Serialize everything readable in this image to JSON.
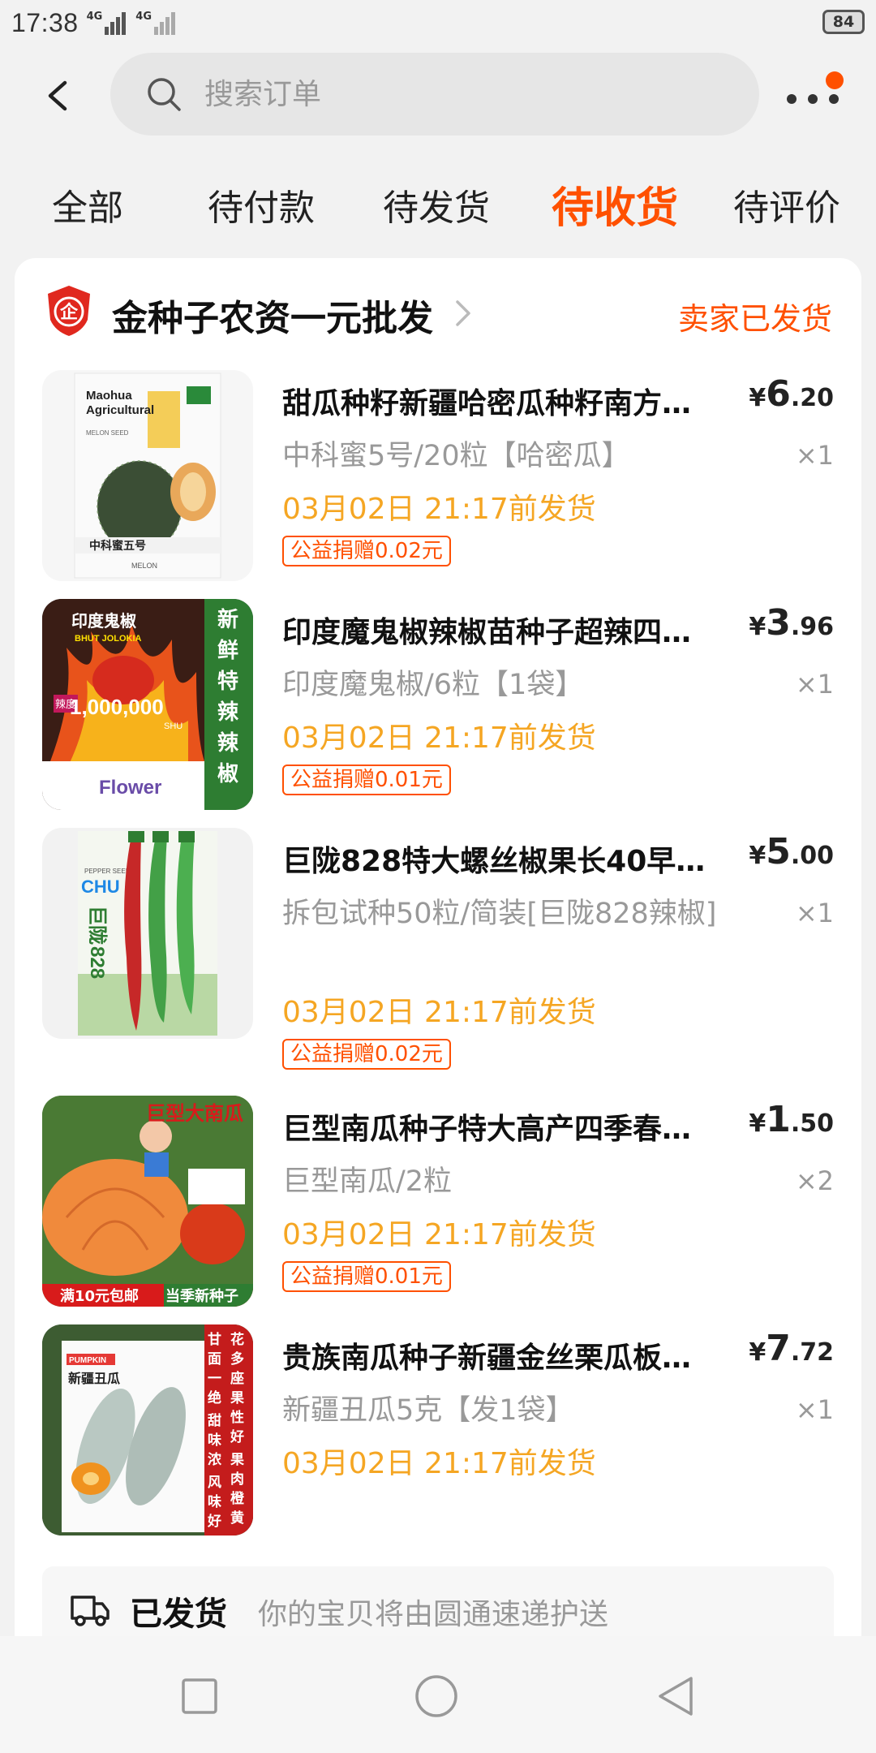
{
  "status_bar": {
    "time": "17:38",
    "network1": "4G",
    "network2": "4G",
    "battery": "84"
  },
  "search": {
    "placeholder": "搜索订单"
  },
  "tabs": [
    {
      "label": "全部"
    },
    {
      "label": "待付款"
    },
    {
      "label": "待发货"
    },
    {
      "label": "待收货",
      "active": true
    },
    {
      "label": "待评价"
    }
  ],
  "shop": {
    "logo_text": "企",
    "name": "金种子农资一元批发",
    "status": "卖家已发货"
  },
  "items": [
    {
      "title": "甜瓜种籽新疆哈密瓜种籽南方…",
      "price_currency": "¥",
      "price_int": "6",
      "price_dec": ".20",
      "sku": "中科蜜5号/20粒【哈密瓜】",
      "qty": "×1",
      "ship": "03月02日 21:17前发货",
      "donate": "公益捐赠0.02元",
      "thumb_text": [
        "Maohua",
        "Agricultural",
        "MELON SEED",
        "中科蜜五号",
        "MELON"
      ]
    },
    {
      "title": "印度魔鬼椒辣椒苗种子超辣四…",
      "price_currency": "¥",
      "price_int": "3",
      "price_dec": ".96",
      "sku": "印度魔鬼椒/6粒【1袋】",
      "qty": "×1",
      "ship": "03月02日 21:17前发货",
      "donate": "公益捐赠0.01元",
      "thumb_text": [
        "印度鬼椒",
        "BHUT JOLOKIA",
        "辣度",
        "1,000,000",
        "SHU",
        "Flower",
        "新鲜特辣辣椒"
      ]
    },
    {
      "title": "巨陇828特大螺丝椒果长40早…",
      "price_currency": "¥",
      "price_int": "5",
      "price_dec": ".00",
      "sku": "拆包试种50粒/简装[巨陇828辣椒]",
      "qty": "×1",
      "ship": "03月02日 21:17前发货",
      "donate": "公益捐赠0.02元",
      "thumb_text": [
        "PEPPER SEED",
        "CHU",
        "巨陇",
        "828"
      ]
    },
    {
      "title": "巨型南瓜种子特大高产四季春…",
      "price_currency": "¥",
      "price_int": "1",
      "price_dec": ".50",
      "sku": "巨型南瓜/2粒",
      "qty": "×2",
      "ship": "03月02日 21:17前发货",
      "donate": "公益捐赠0.01元",
      "thumb_text": [
        "巨型大南瓜",
        "满10元包邮",
        "当季新种子"
      ]
    },
    {
      "title": "贵族南瓜种子新疆金丝栗瓜板…",
      "price_currency": "¥",
      "price_int": "7",
      "price_dec": ".72",
      "sku": "新疆丑瓜5克【发1袋】",
      "qty": "×1",
      "ship": "03月02日 21:17前发货",
      "donate": "",
      "thumb_text": [
        "PUMPKIN",
        "新疆丑瓜",
        "甘面一绝",
        "甜味浓",
        "风味好",
        "花多座果性好",
        "果肉橙黄色"
      ]
    }
  ],
  "delivery": {
    "label": "已发货",
    "desc": "你的宝贝将由圆通速递护送"
  },
  "colors": {
    "accent": "#ff5000",
    "ship_text": "#f5a623",
    "muted": "#999999"
  },
  "icons": [
    "back-arrow-icon",
    "search-icon",
    "more-icon",
    "shop-logo-icon",
    "chevron-right-icon",
    "truck-icon",
    "nav-recents-icon",
    "nav-home-icon",
    "nav-back-icon"
  ]
}
